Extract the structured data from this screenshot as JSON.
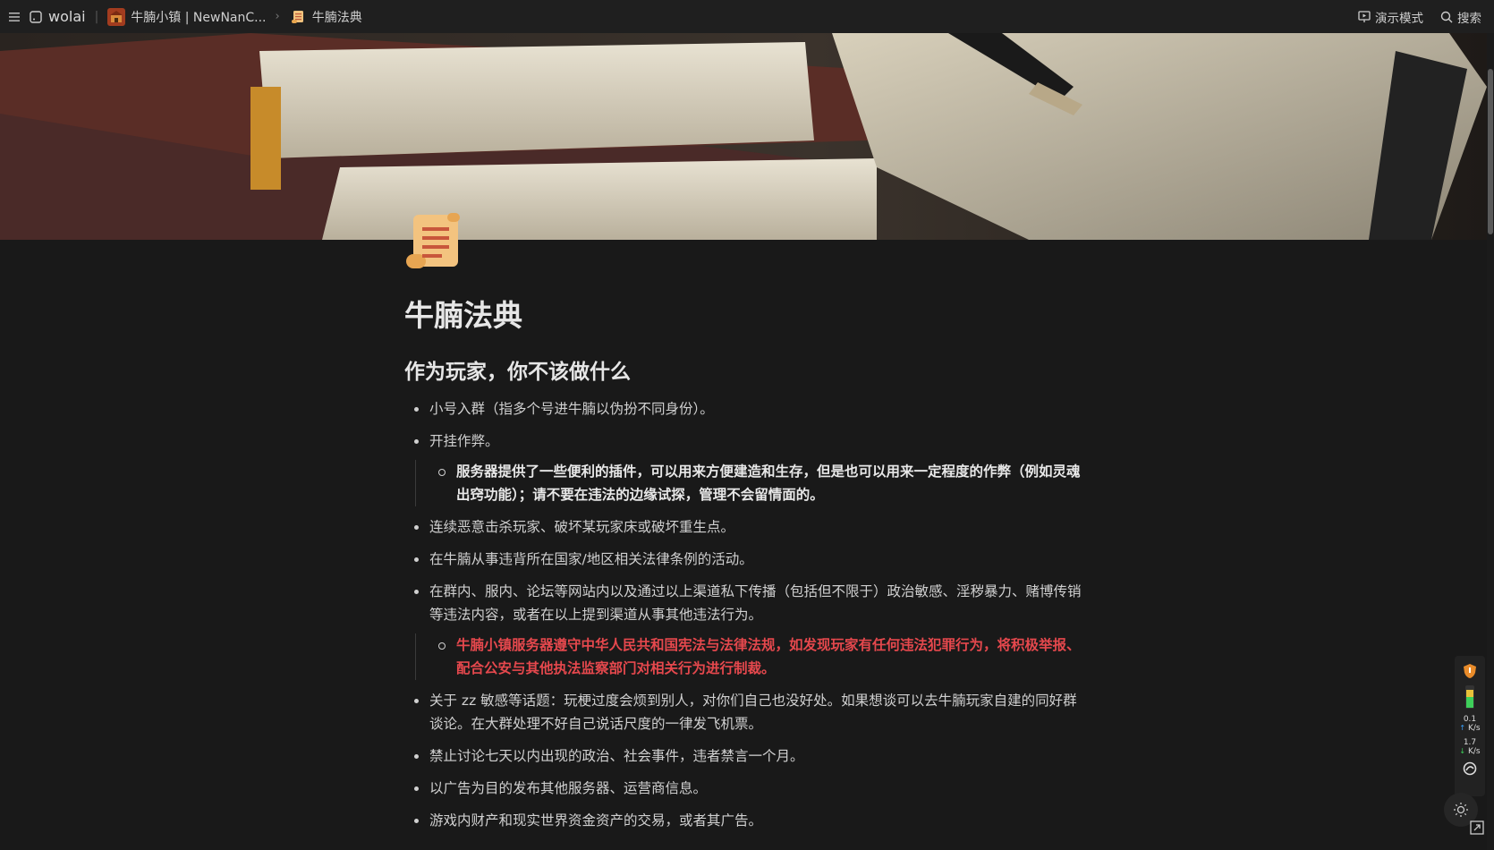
{
  "topbar": {
    "app_name": "wolai",
    "breadcrumb": [
      {
        "label": "牛腩小镇 | NewNanC..."
      },
      {
        "label": "牛腩法典"
      }
    ],
    "present_label": "演示模式",
    "search_label": "搜索"
  },
  "page": {
    "title": "牛腩法典",
    "heading": "作为玩家，你不该做什么",
    "items": [
      {
        "text": "小号入群（指多个号进牛腩以伪扮不同身份）。"
      },
      {
        "text": "开挂作弊。"
      },
      {
        "sub": "服务器提供了一些便利的插件，可以用来方便建造和生存，但是也可以用来一定程度的作弊（例如灵魂出窍功能）；请不要在违法的边缘试探，管理不会留情面的。"
      },
      {
        "text": "连续恶意击杀玩家、破坏某玩家床或破坏重生点。"
      },
      {
        "text": "在牛腩从事违背所在国家/地区相关法律条例的活动。"
      },
      {
        "text": "在群内、服内、论坛等网站内以及通过以上渠道私下传播（包括但不限于）政治敏感、淫秽暴力、赌博传销等违法内容，或者在以上提到渠道从事其他违法行为。"
      },
      {
        "sub_red": "牛腩小镇服务器遵守中华人民共和国宪法与法律法规，如发现玩家有任何违法犯罪行为，将积极举报、配合公安与其他执法监察部门对相关行为进行制裁。"
      },
      {
        "text": "关于 zz 敏感等话题：玩梗过度会烦到别人，对你们自己也没好处。如果想谈可以去牛腩玩家自建的同好群谈论。在大群处理不好自己说话尺度的一律发飞机票。"
      },
      {
        "text": "禁止讨论七天以内出现的政治、社会事件，违者禁言一个月。"
      },
      {
        "text": "以广告为目的发布其他服务器、运营商信息。"
      },
      {
        "text": "游戏内财产和现实世界资金资产的交易，或者其广告。"
      }
    ]
  },
  "widget": {
    "up_speed": "0.1",
    "up_unit": "K/s",
    "down_speed": "1.7",
    "down_unit": "K/s"
  },
  "colors": {
    "background": "#191919",
    "topbar": "#1f1f1f",
    "warning_red": "#e5484d"
  }
}
